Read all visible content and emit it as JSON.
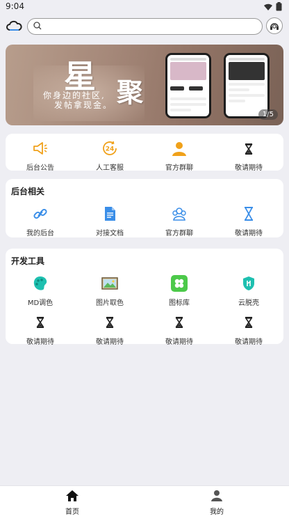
{
  "status_bar": {
    "time": "9:04",
    "wifi_icon": "wifi-icon",
    "battery_icon": "battery-icon"
  },
  "search": {
    "placeholder": ""
  },
  "banner": {
    "title_1": "星",
    "title_2": "聚",
    "subtitle_1": "你身边的社区,",
    "subtitle_2": "发帖拿现金。",
    "pager": "1/5"
  },
  "quick": [
    {
      "label": "后台公告",
      "icon": "megaphone-icon"
    },
    {
      "label": "人工客服",
      "icon": "support-24-icon"
    },
    {
      "label": "官方群聊",
      "icon": "person-icon"
    },
    {
      "label": "敬请期待",
      "icon": "hourglass-icon"
    }
  ],
  "backend": {
    "title": "后台相关",
    "items": [
      {
        "label": "我的后台",
        "icon": "link-icon"
      },
      {
        "label": "对接文档",
        "icon": "document-icon"
      },
      {
        "label": "官方群聊",
        "icon": "group-icon"
      },
      {
        "label": "敬请期待",
        "icon": "hourglass-icon"
      }
    ]
  },
  "tools": {
    "title": "开发工具",
    "items": [
      {
        "label": "MD调色",
        "icon": "palette-icon"
      },
      {
        "label": "图片取色",
        "icon": "image-icon"
      },
      {
        "label": "图标库",
        "icon": "icon-library-icon"
      },
      {
        "label": "云脱壳",
        "icon": "shield-icon"
      },
      {
        "label": "敬请期待",
        "icon": "hourglass-icon"
      },
      {
        "label": "敬请期待",
        "icon": "hourglass-icon"
      },
      {
        "label": "敬请期待",
        "icon": "hourglass-icon"
      },
      {
        "label": "敬请期待",
        "icon": "hourglass-icon"
      }
    ]
  },
  "tabbar": {
    "home": "首页",
    "mine": "我的"
  },
  "colors": {
    "accent_orange": "#f0a11a",
    "accent_blue": "#3a8ee8",
    "accent_teal": "#1ec0b0",
    "accent_green": "#4cc94a",
    "background": "#eeeef3"
  }
}
